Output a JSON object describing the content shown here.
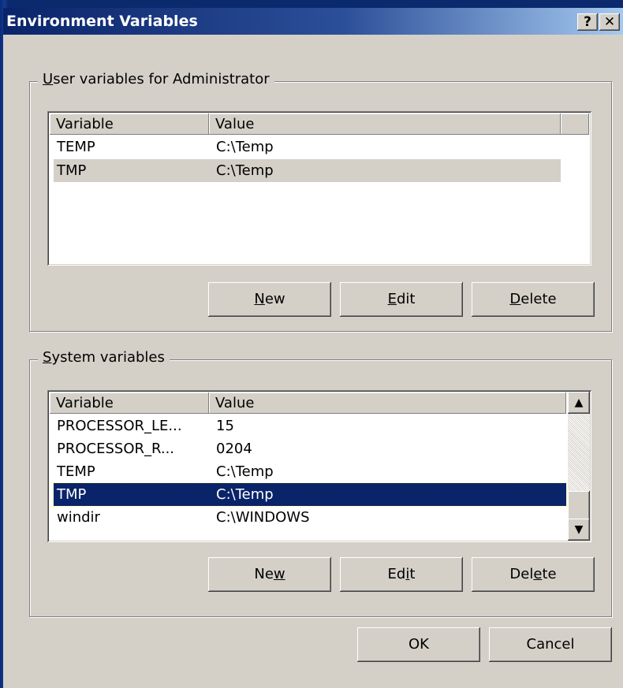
{
  "window": {
    "title": "Environment Variables",
    "help_label": "?",
    "close_label": "✕"
  },
  "user_vars": {
    "group_label_prefix": "U",
    "group_label_rest": "ser variables for Administrator",
    "columns": [
      "Variable",
      "Value"
    ],
    "rows": [
      {
        "variable": "TEMP",
        "value": "C:\\Temp"
      },
      {
        "variable": "TMP",
        "value": "C:\\Temp"
      }
    ],
    "buttons": {
      "new": {
        "mn": "N",
        "rest": "ew"
      },
      "edit": {
        "mn": "E",
        "rest": "dit"
      },
      "delete": {
        "mn": "D",
        "rest": "elete"
      }
    }
  },
  "system_vars": {
    "group_label_prefix": "S",
    "group_label_rest": "ystem variables",
    "columns": [
      "Variable",
      "Value"
    ],
    "rows": [
      {
        "variable": "PROCESSOR_LE...",
        "value": "15"
      },
      {
        "variable": "PROCESSOR_R...",
        "value": "0204"
      },
      {
        "variable": "TEMP",
        "value": "C:\\Temp"
      },
      {
        "variable": "TMP",
        "value": "C:\\Temp"
      },
      {
        "variable": "windir",
        "value": "C:\\WINDOWS"
      }
    ],
    "buttons": {
      "new": {
        "pre": "Ne",
        "mn": "w"
      },
      "edit": {
        "pre": "Ed",
        "mn": "i",
        "rest": "t"
      },
      "delete": {
        "pre": "Del",
        "mn": "e",
        "rest": "te"
      }
    }
  },
  "footer": {
    "ok_label": "OK",
    "cancel_label": "Cancel"
  },
  "icons": {
    "scroll_up": "▲",
    "scroll_down": "▼"
  }
}
